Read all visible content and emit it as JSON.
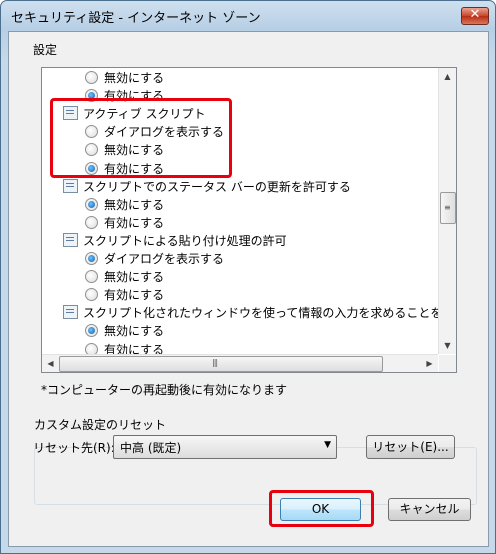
{
  "window": {
    "title": "セキュリティ設定 - インターネット ゾーン"
  },
  "settings_group": {
    "label": "設定"
  },
  "settings_list": [
    {
      "kind": "option",
      "label": "無効にする",
      "selected": false
    },
    {
      "kind": "option",
      "label": "有効にする",
      "selected": true
    },
    {
      "kind": "category",
      "label": "アクティブ スクリプト"
    },
    {
      "kind": "option",
      "label": "ダイアログを表示する",
      "selected": false
    },
    {
      "kind": "option",
      "label": "無効にする",
      "selected": false
    },
    {
      "kind": "option",
      "label": "有効にする",
      "selected": true
    },
    {
      "kind": "category",
      "label": "スクリプトでのステータス バーの更新を許可する"
    },
    {
      "kind": "option",
      "label": "無効にする",
      "selected": true
    },
    {
      "kind": "option",
      "label": "有効にする",
      "selected": false
    },
    {
      "kind": "category",
      "label": "スクリプトによる貼り付け処理の許可"
    },
    {
      "kind": "option",
      "label": "ダイアログを表示する",
      "selected": true
    },
    {
      "kind": "option",
      "label": "無効にする",
      "selected": false
    },
    {
      "kind": "option",
      "label": "有効にする",
      "selected": false
    },
    {
      "kind": "category",
      "label": "スクリプト化されたウィンドウを使って情報の入力を求めることを Web サイトに"
    },
    {
      "kind": "option",
      "label": "無効にする",
      "selected": true
    },
    {
      "kind": "option",
      "label": "有効にする",
      "selected": false
    }
  ],
  "note": "*コンピューターの再起動後に有効になります",
  "reset_group": {
    "label": "カスタム設定のリセット",
    "reset_to_label": "リセット先(R):",
    "reset_to_value": "中高 (既定)",
    "reset_button": "リセット(E)..."
  },
  "buttons": {
    "ok": "OK",
    "cancel": "キャンセル"
  },
  "colors": {
    "highlight": "#e8000f",
    "title_bar": "#b7cfe5",
    "dialog_bg": "#f0f0f0"
  }
}
